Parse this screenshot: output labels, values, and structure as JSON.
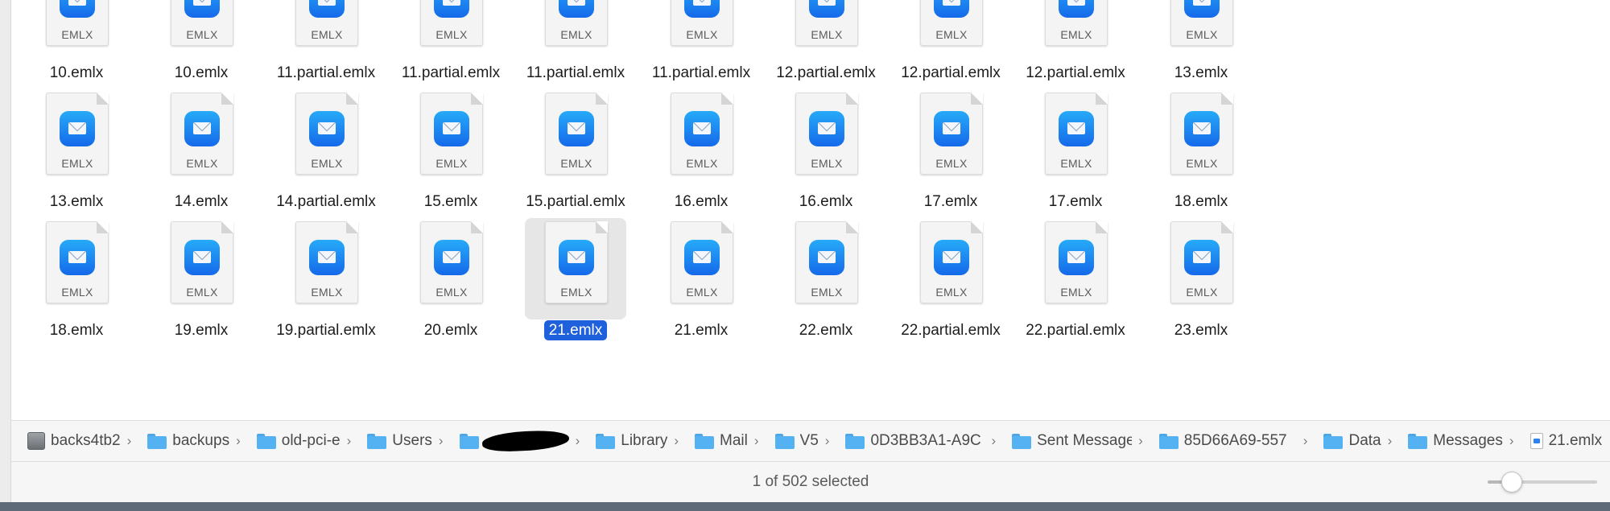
{
  "files": {
    "ext_label": "EMLX",
    "icon": "mail-document-icon",
    "rows": [
      [
        "10.emlx",
        "10.emlx",
        "11.partial.emlx",
        "11.partial.emlx",
        "11.partial.emlx",
        "11.partial.emlx",
        "12.partial.emlx",
        "12.partial.emlx",
        "12.partial.emlx",
        "13.emlx"
      ],
      [
        "13.emlx",
        "14.emlx",
        "14.partial.emlx",
        "15.emlx",
        "15.partial.emlx",
        "16.emlx",
        "16.emlx",
        "17.emlx",
        "17.emlx",
        "18.emlx"
      ],
      [
        "18.emlx",
        "19.emlx",
        "19.partial.emlx",
        "20.emlx",
        "21.emlx",
        "21.emlx",
        "22.emlx",
        "22.partial.emlx",
        "22.partial.emlx",
        "23.emlx"
      ]
    ],
    "selected": {
      "row": 2,
      "col": 4
    }
  },
  "path_bar": {
    "crumbs": [
      {
        "label": "backs4tb2",
        "icon": "disk-icon"
      },
      {
        "label": "backups",
        "icon": "folder-icon"
      },
      {
        "label": "old-pci-e",
        "icon": "folder-icon"
      },
      {
        "label": "Users",
        "icon": "folder-icon"
      },
      {
        "label": "",
        "icon": "folder-icon",
        "redacted": true
      },
      {
        "label": "Library",
        "icon": "folder-icon"
      },
      {
        "label": "Mail",
        "icon": "folder-icon"
      },
      {
        "label": "V5",
        "icon": "folder-icon"
      },
      {
        "label": "0D3BB3A1-A9C",
        "icon": "folder-icon"
      },
      {
        "label": "Sent Messages.",
        "icon": "folder-icon"
      },
      {
        "label": "85D66A69-557",
        "icon": "folder-icon"
      },
      {
        "label": "Data",
        "icon": "folder-icon"
      },
      {
        "label": "Messages",
        "icon": "folder-icon"
      },
      {
        "label": "21.emlx",
        "icon": "document-icon"
      }
    ],
    "separator": "›"
  },
  "status": {
    "text": "1 of 502 selected",
    "zoom_level": 0.22
  },
  "colors": {
    "selection": "#1f60dc",
    "accent": "#1f60dc"
  }
}
